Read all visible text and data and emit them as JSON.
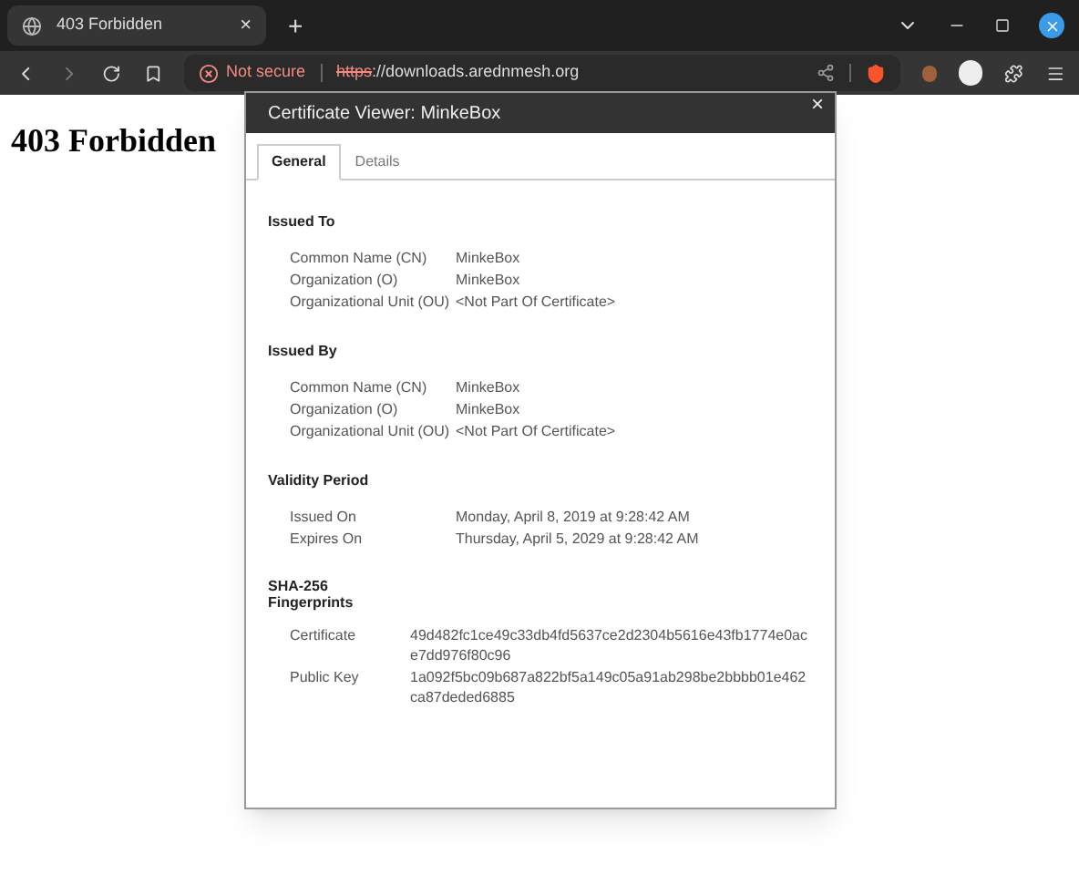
{
  "browser": {
    "tab": {
      "title": "403 Forbidden",
      "close": "×"
    },
    "new_tab": "+",
    "address": {
      "security": "Not secure",
      "scheme": "https",
      "rest": "://downloads.arednmesh.org"
    }
  },
  "page": {
    "heading": "403 Forbidden"
  },
  "dialog": {
    "title": "Certificate Viewer: MinkeBox",
    "close": "×",
    "tabs": [
      {
        "label": "General",
        "selected": true
      },
      {
        "label": "Details",
        "selected": false
      }
    ],
    "sections": [
      {
        "title": "Issued To",
        "kind": "fields",
        "rows": [
          {
            "label": "Common Name (CN)",
            "value": "MinkeBox"
          },
          {
            "label": "Organization (O)",
            "value": "MinkeBox"
          },
          {
            "label": "Organizational Unit (OU)",
            "value": "<Not Part Of Certificate>"
          }
        ]
      },
      {
        "title": "Issued By",
        "kind": "fields",
        "rows": [
          {
            "label": "Common Name (CN)",
            "value": "MinkeBox"
          },
          {
            "label": "Organization (O)",
            "value": "MinkeBox"
          },
          {
            "label": "Organizational Unit (OU)",
            "value": "<Not Part Of Certificate>"
          }
        ]
      },
      {
        "title": "Validity Period",
        "kind": "fields",
        "rows": [
          {
            "label": "Issued On",
            "value": "Monday, April 8, 2019 at 9:28:42 AM"
          },
          {
            "label": "Expires On",
            "value": "Thursday, April 5, 2029 at 9:28:42 AM"
          }
        ]
      },
      {
        "title": "SHA-256 Fingerprints",
        "kind": "hashes",
        "rows": [
          {
            "label": "Certificate",
            "value": "49d482fc1ce49c33db4fd5637ce2d2304b5616e43fb1774e0ace7dd976f80c96"
          },
          {
            "label": "Public Key",
            "value": "1a092f5bc09b687a822bf5a149c05a91ab298be2bbbb01e462ca87deded6885"
          }
        ]
      }
    ]
  }
}
